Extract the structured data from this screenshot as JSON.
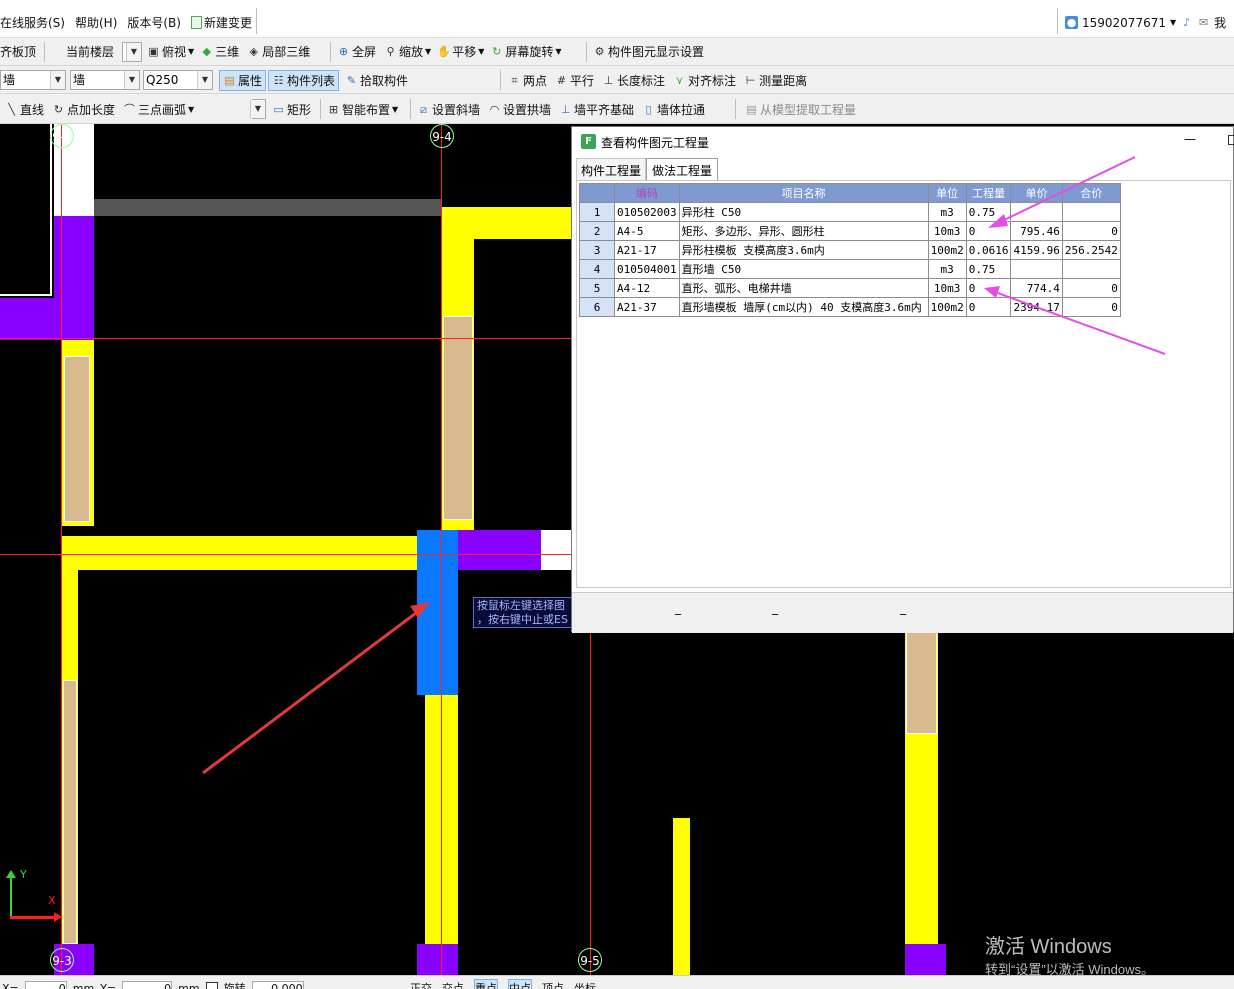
{
  "menu": {
    "items": [
      "在线服务(S)",
      "帮助(H)",
      "版本号(B)"
    ],
    "new_change": "新建变更",
    "account": "15902077671",
    "account_extra": "我"
  },
  "toolbar1": {
    "align_top": "齐板顶",
    "floor_label": "当前楼层",
    "view_top": "俯视",
    "view_3d": "三维",
    "local_3d": "局部三维",
    "fullscreen": "全屏",
    "zoom": "缩放",
    "pan": "平移",
    "rotate": "屏幕旋转",
    "display_settings": "构件图元显示设置"
  },
  "toolbar2": {
    "type_select": "墙",
    "sub_select": "墙",
    "name_select": "Q250",
    "attributes": "属性",
    "component_list": "构件列表",
    "pick_component": "拾取构件",
    "two_points": "两点",
    "parallel": "平行",
    "length_dim": "长度标注",
    "align_dim": "对齐标注",
    "measure": "测量距离"
  },
  "toolbar3": {
    "line": "直线",
    "point_length": "点加长度",
    "arc3": "三点画弧",
    "rect": "矩形",
    "smart_layout": "智能布置",
    "slope_wall": "设置斜墙",
    "arch_wall": "设置拱墙",
    "wall_foundation": "墙平齐基础",
    "wall_stretch": "墙体拉通",
    "extract_qty": "从模型提取工程量"
  },
  "canvas": {
    "axes": [
      "9-3",
      "9-4",
      "9-3",
      "9-5"
    ],
    "tooltip_line1": "按鼠标左键选择图",
    "tooltip_line2": "，按右键中止或ES",
    "ucs_x": "X",
    "ucs_y": "Y"
  },
  "dialog": {
    "title": "查看构件图元工程量",
    "minimize": "—",
    "tabs": [
      "构件工程量",
      "做法工程量"
    ],
    "columns": [
      "编码",
      "项目名称",
      "单位",
      "工程量",
      "单价",
      "合价"
    ],
    "rows": [
      {
        "n": "1",
        "code": "010502003",
        "name": "异形柱  C50",
        "unit": "m3",
        "qty": "0.75",
        "price": "",
        "total": ""
      },
      {
        "n": "2",
        "code": "A4-5",
        "name": "矩形、多边形、异形、圆形柱",
        "unit": "10m3",
        "qty": "0",
        "price": "795.46",
        "total": "0"
      },
      {
        "n": "3",
        "code": "A21-17",
        "name": "异形柱模板 支模高度3.6m内",
        "unit": "100m2",
        "qty": "0.0616",
        "price": "4159.96",
        "total": "256.2542"
      },
      {
        "n": "4",
        "code": "010504001",
        "name": "直形墙  C50",
        "unit": "m3",
        "qty": "0.75",
        "price": "",
        "total": ""
      },
      {
        "n": "5",
        "code": "A4-12",
        "name": "直形、弧形、电梯井墙",
        "unit": "10m3",
        "qty": "0",
        "price": "774.4",
        "total": "0"
      },
      {
        "n": "6",
        "code": "A21-37",
        "name": "直形墙模板 墙厚(cm以内) 40 支模高度3.6m内",
        "unit": "100m2",
        "qty": "0",
        "price": "2394.17",
        "total": "0"
      }
    ],
    "footer_marks": [
      "_",
      "_",
      "_"
    ]
  },
  "watermark": {
    "line1": "激活 Windows",
    "line2": "转到“设置”以激活 Windows。"
  },
  "statusbar": {
    "x_label": "X=",
    "x_value": "0",
    "y_label": "Y=",
    "y_value": "0",
    "unit": "mm",
    "rotate": "旋转",
    "angle": "0.000",
    "snaps": [
      "正交",
      "交点",
      "重点",
      "中点",
      "顶点",
      "坐标"
    ]
  },
  "colors": {
    "yellow": "#ffff00",
    "purple": "#8a00ff",
    "blue": "#0a78ff",
    "arrow_red": "#e03a3a",
    "arrow_magenta": "#e64ce6"
  }
}
